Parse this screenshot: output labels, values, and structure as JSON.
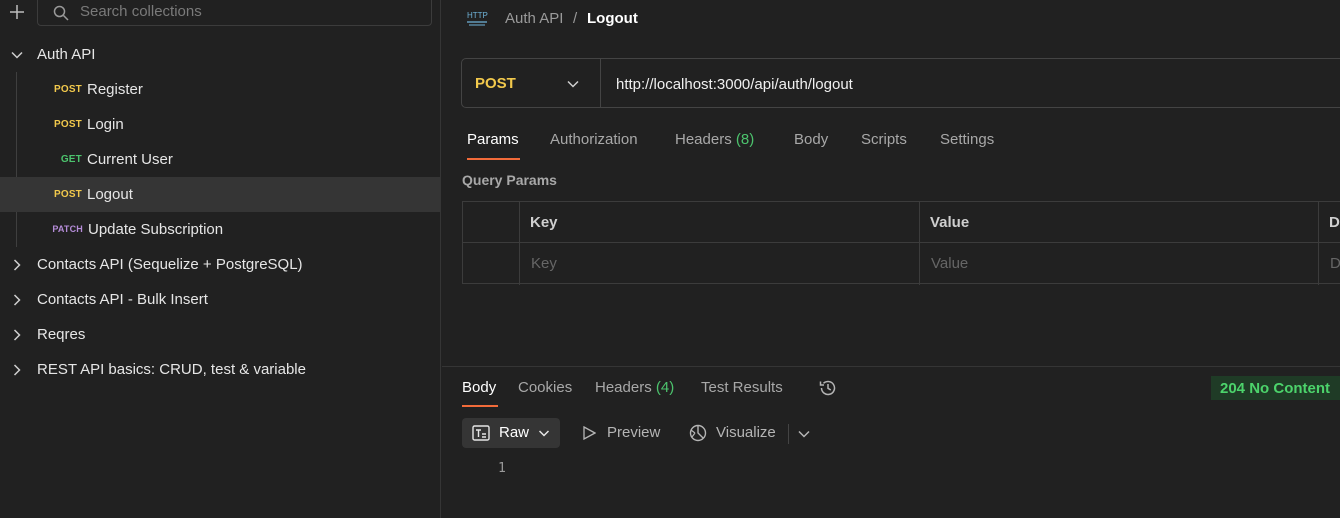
{
  "sidebar": {
    "search_placeholder": "Search collections",
    "collections": [
      {
        "label": "Auth API",
        "expanded": true,
        "requests": [
          {
            "method": "POST",
            "label": "Register"
          },
          {
            "method": "POST",
            "label": "Login"
          },
          {
            "method": "GET",
            "label": "Current User"
          },
          {
            "method": "POST",
            "label": "Logout",
            "selected": true
          },
          {
            "method": "PATCH",
            "label": "Update Subscription"
          }
        ]
      },
      {
        "label": "Contacts API (Sequelize + PostgreSQL)",
        "expanded": false
      },
      {
        "label": "Contacts API - Bulk Insert",
        "expanded": false
      },
      {
        "label": "Reqres",
        "expanded": false
      },
      {
        "label": "REST API basics: CRUD, test & variable",
        "expanded": false
      }
    ]
  },
  "breadcrumb": {
    "parent": "Auth API",
    "separator": "/",
    "current": "Logout"
  },
  "request": {
    "method": "POST",
    "url": "http://localhost:3000/api/auth/logout",
    "tabs": {
      "params": "Params",
      "authorization": "Authorization",
      "headers": "Headers",
      "headers_count": "(8)",
      "body": "Body",
      "scripts": "Scripts",
      "settings": "Settings"
    },
    "query_params": {
      "title": "Query Params",
      "columns": [
        "Key",
        "Value",
        "D"
      ],
      "placeholders": [
        "Key",
        "Value",
        "D"
      ]
    }
  },
  "response": {
    "tabs": {
      "body": "Body",
      "cookies": "Cookies",
      "headers": "Headers",
      "headers_count": "(4)",
      "test_results": "Test Results"
    },
    "status": "204 No Content",
    "format": "Raw",
    "preview": "Preview",
    "visualize": "Visualize",
    "line_number": "1"
  },
  "colors": {
    "post": "#f2c94c",
    "get": "#4cc36d",
    "patch": "#b58cd8",
    "accent": "#f26b3a",
    "success": "#4cd36b"
  }
}
